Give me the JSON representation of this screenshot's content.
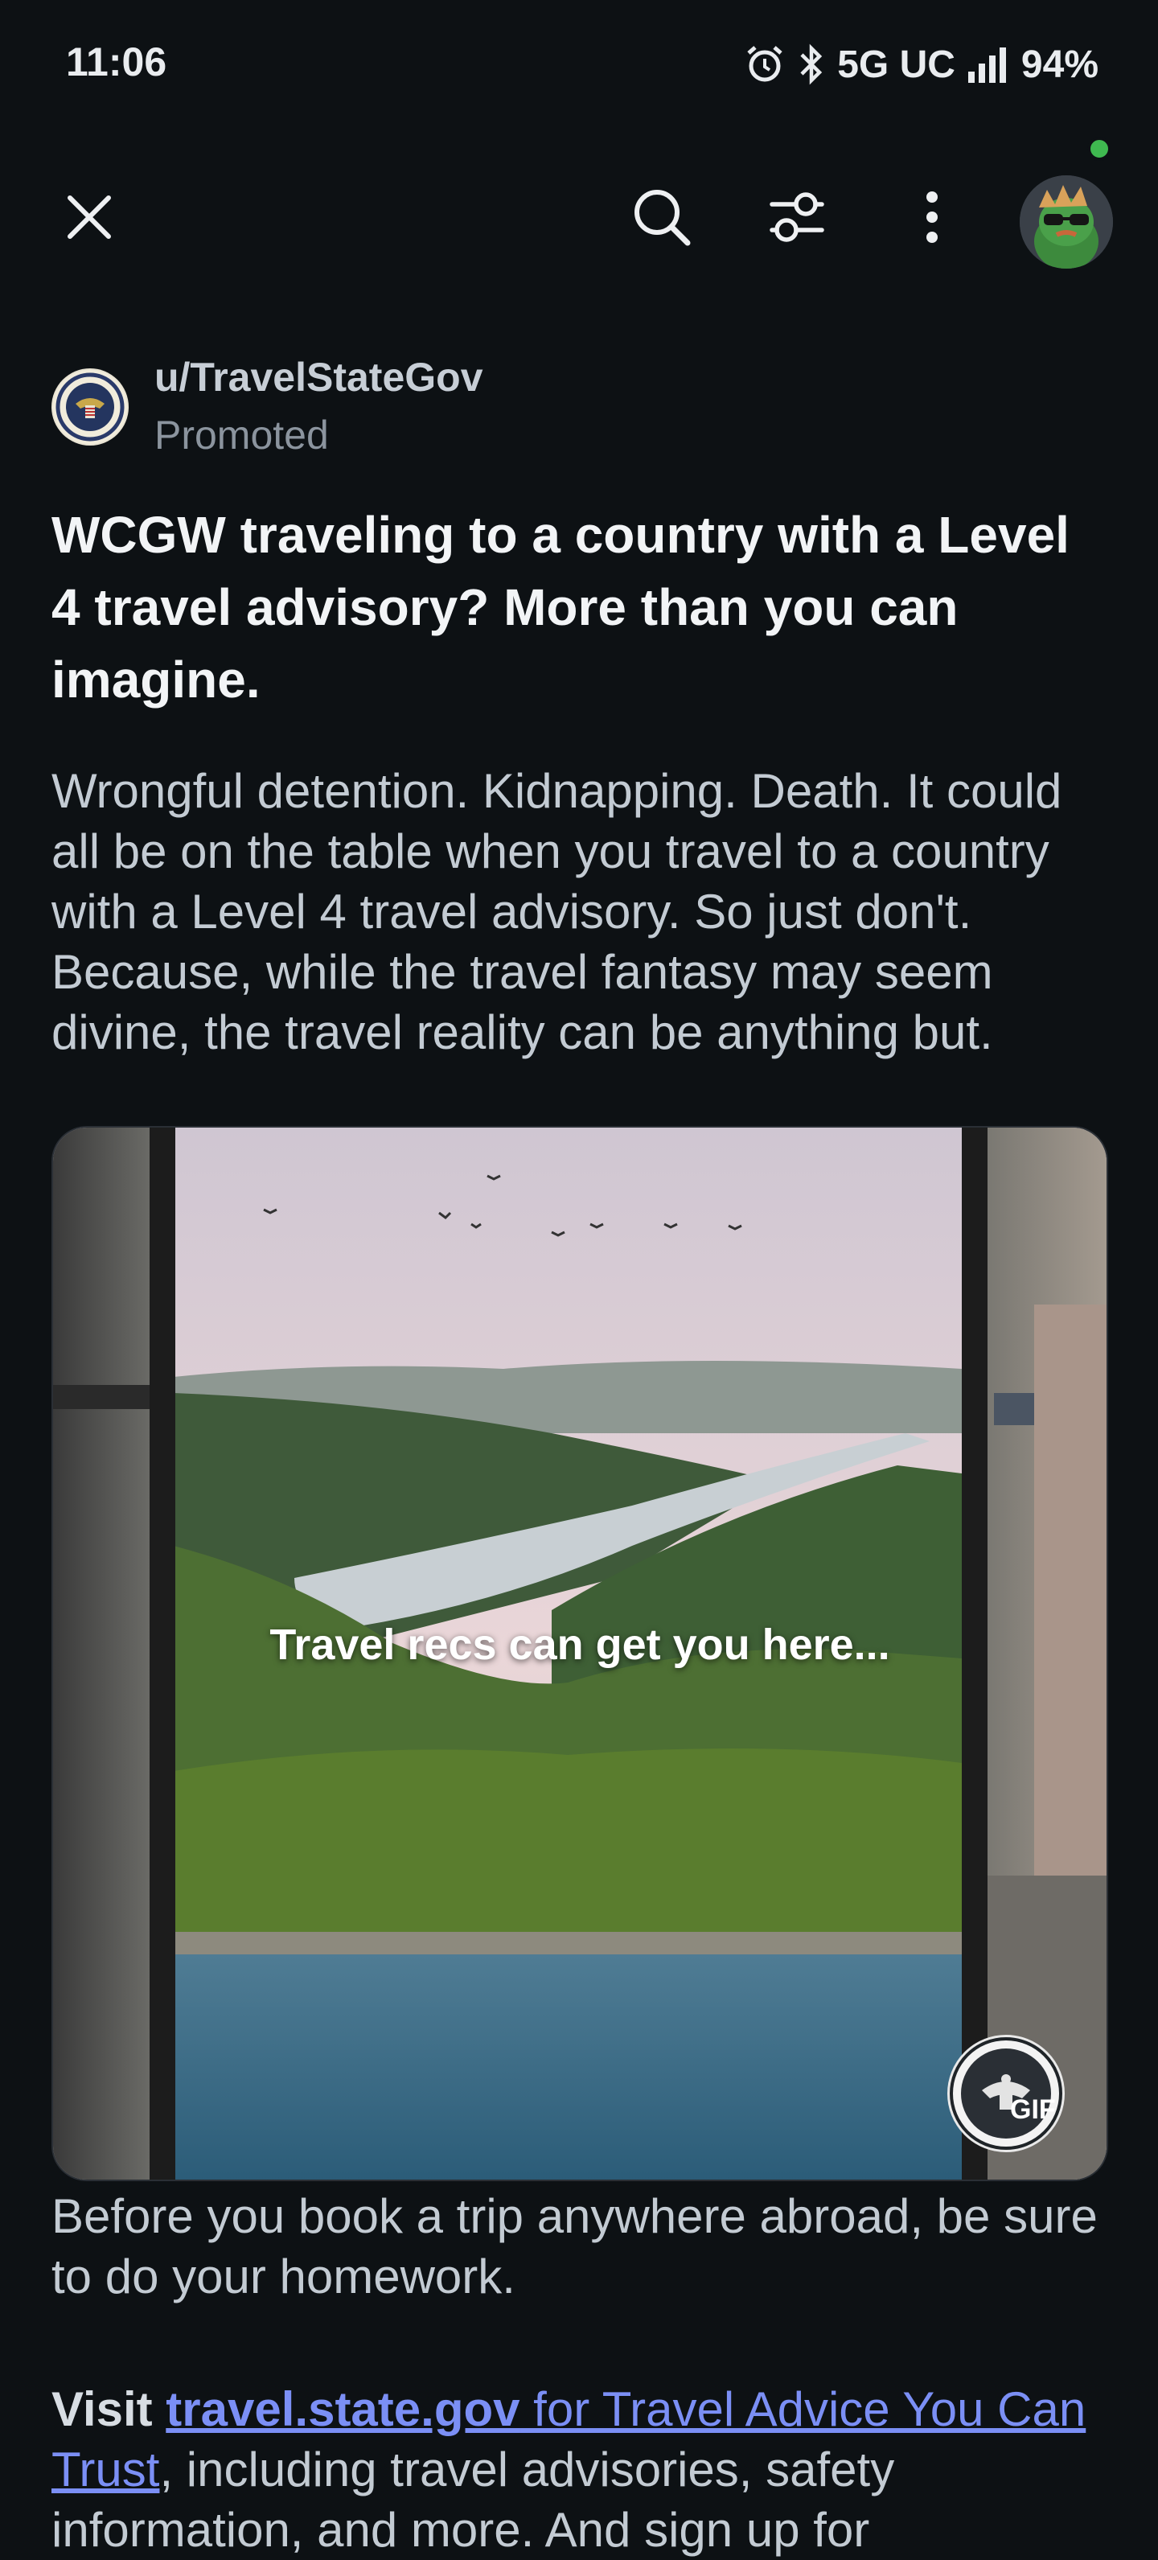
{
  "status_bar": {
    "time": "11:06",
    "network": "5G UC",
    "battery": "94%",
    "icons": [
      "alarm-icon",
      "bluetooth-icon",
      "signal-icon"
    ]
  },
  "toolbar": {
    "icons": [
      "close-icon",
      "search-icon",
      "filter-icon",
      "more-options-icon",
      "user-avatar"
    ],
    "online_dot_color": "#3fb950"
  },
  "post": {
    "author": "u/TravelStateGov",
    "promoted_label": "Promoted",
    "title": "WCGW traveling to a country with a Level 4 travel advisory? More than you can imagine.",
    "body": "Wrongful detention. Kidnapping. Death. It could all be on the table when you travel to a country with a Level 4 travel advisory. So just don't. Because, while the travel fantasy may seem divine, the travel reality can be anything but.",
    "media": {
      "caption": "Travel recs can get you here...",
      "badge": "GIF"
    },
    "after_media_text": "Before you book a trip anywhere abroad, be sure to do your homework.",
    "visit": {
      "prefix": "Visit ",
      "link_bold": "travel.state.gov",
      "link_rest": " for Travel Advice You Can Trust",
      "suffix": ", including travel advisories, safety information, and more. And sign up for"
    }
  },
  "colors": {
    "background": "#0d1114",
    "link": "#7b8ff5",
    "text_primary": "#f2f4f6",
    "text_secondary": "#c3cbd3",
    "text_muted": "#8b949e"
  }
}
